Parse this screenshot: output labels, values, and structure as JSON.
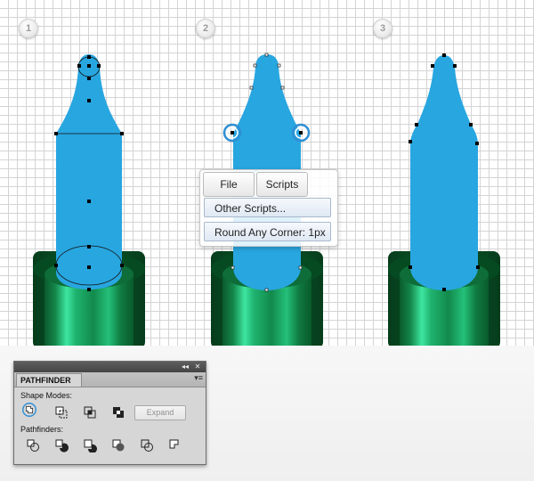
{
  "steps": [
    "1",
    "2",
    "3"
  ],
  "menu": {
    "tabs": [
      "File",
      "Scripts"
    ],
    "items": [
      "Other Scripts...",
      "Round Any Corner: 1px"
    ]
  },
  "pathfinder": {
    "panel_title": "PATHFINDER",
    "collapse_label": "◂◂",
    "close_label": "✕",
    "menu_label": "▾≡",
    "shape_modes_label": "Shape Modes:",
    "pathfinders_label": "Pathfinders:",
    "expand_label": "Expand",
    "shape_mode_icons": [
      "unite-icon",
      "minus-front-icon",
      "intersect-icon",
      "exclude-icon"
    ],
    "pathfinder_icons": [
      "divide-icon",
      "trim-icon",
      "merge-icon",
      "crop-icon",
      "outline-icon",
      "minus-back-icon"
    ]
  },
  "colors": {
    "bottle_blue": "#28a6e0",
    "cap_dark_green": "#0a5a2a",
    "cap_green": "#1aa868",
    "cap_highlight": "#3fe8a0",
    "selection_ring": "#2f8fd4"
  }
}
